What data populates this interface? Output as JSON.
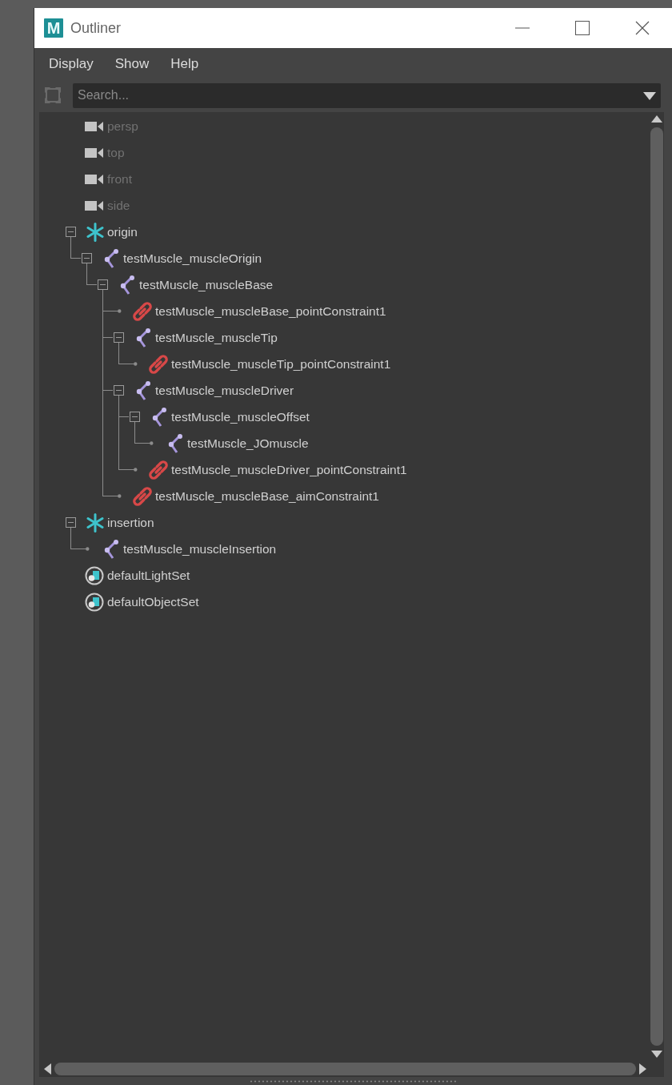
{
  "window": {
    "logo_text": "M",
    "title": "Outliner"
  },
  "menu": [
    {
      "label": "Display"
    },
    {
      "label": "Show"
    },
    {
      "label": "Help"
    }
  ],
  "search": {
    "placeholder": "Search..."
  },
  "tree": [
    {
      "label": "persp",
      "kind": "camera",
      "hidden": true
    },
    {
      "label": "top",
      "kind": "camera",
      "hidden": true
    },
    {
      "label": "front",
      "kind": "camera",
      "hidden": true
    },
    {
      "label": "side",
      "kind": "camera",
      "hidden": true
    },
    {
      "label": "origin",
      "kind": "locator",
      "hidden": false,
      "expanded": true,
      "children": [
        {
          "label": "testMuscle_muscleOrigin",
          "kind": "joint",
          "hidden": false,
          "expanded": true,
          "children": [
            {
              "label": "testMuscle_muscleBase",
              "kind": "joint",
              "hidden": false,
              "expanded": true,
              "children": [
                {
                  "label": "testMuscle_muscleBase_pointConstraint1",
                  "kind": "constraint",
                  "hidden": false
                },
                {
                  "label": "testMuscle_muscleTip",
                  "kind": "joint",
                  "hidden": false,
                  "expanded": true,
                  "children": [
                    {
                      "label": "testMuscle_muscleTip_pointConstraint1",
                      "kind": "constraint",
                      "hidden": false
                    }
                  ]
                },
                {
                  "label": "testMuscle_muscleDriver",
                  "kind": "joint",
                  "hidden": false,
                  "expanded": true,
                  "children": [
                    {
                      "label": "testMuscle_muscleOffset",
                      "kind": "joint",
                      "hidden": false,
                      "expanded": true,
                      "children": [
                        {
                          "label": "testMuscle_JOmuscle",
                          "kind": "joint",
                          "hidden": false
                        }
                      ]
                    },
                    {
                      "label": "testMuscle_muscleDriver_pointConstraint1",
                      "kind": "constraint",
                      "hidden": false
                    }
                  ]
                },
                {
                  "label": "testMuscle_muscleBase_aimConstraint1",
                  "kind": "constraint",
                  "hidden": false
                }
              ]
            }
          ]
        }
      ]
    },
    {
      "label": "insertion",
      "kind": "locator",
      "hidden": false,
      "expanded": true,
      "children": [
        {
          "label": "testMuscle_muscleInsertion",
          "kind": "joint",
          "hidden": false
        }
      ]
    },
    {
      "label": "defaultLightSet",
      "kind": "set",
      "hidden": false
    },
    {
      "label": "defaultObjectSet",
      "kind": "set",
      "hidden": false
    }
  ]
}
